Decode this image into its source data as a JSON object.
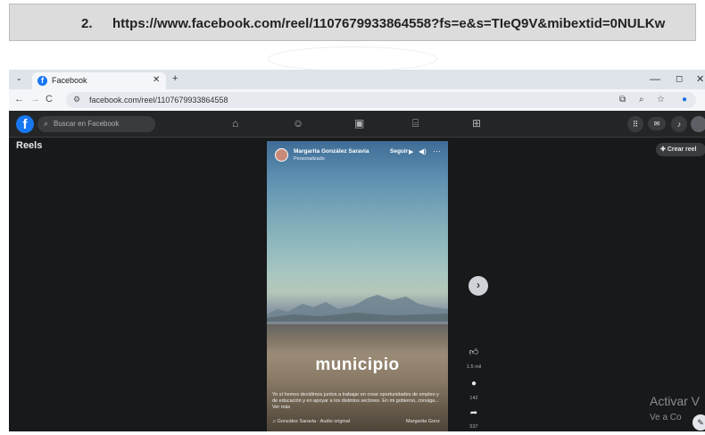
{
  "caption": {
    "number": "2.",
    "url": "https://www.facebook.com/reel/1107679933864558?fs=e&s=TIeQ9V&mibextid=0NULKw"
  },
  "browser": {
    "tab_title": "Facebook",
    "tab_close": "✕",
    "new_tab": "+",
    "tab_menu": "⌄",
    "win_minimize": "—",
    "win_maximize": "◻",
    "win_close": "✕",
    "address": "facebook.com/reel/1107679933864558",
    "nav_back": "←",
    "nav_forward": "→",
    "nav_reload": "C"
  },
  "facebook": {
    "logo": "f",
    "search_placeholder": "Buscar en Facebook",
    "reels_label": "Reels",
    "create_reel": "Crear reel"
  },
  "reel": {
    "author": "Margarita González Saravia",
    "subtitle": "Personalizado",
    "follow": "Seguir",
    "overlay_word": "municipio",
    "caption": "Yo sí hemos decidimos juntos a trabajar en crear oportunidades de empleo y de educación y en apoyar a los distintos sectores. En mi gobierno, consiga... Ver más",
    "audio": "González Saravia · Audio original",
    "audio_right": "Margarita Gonz"
  },
  "actions": {
    "likes": "1.5 mil",
    "comments": "142",
    "shares": "537"
  },
  "windows_activation": {
    "title": "Activar V",
    "subtitle": "Ve a Co"
  },
  "icons": {
    "favicon": "facebook-icon",
    "home": "home-icon",
    "friends": "friends-icon",
    "watch": "video-icon",
    "marketplace": "marketplace-icon",
    "gaming": "gaming-icon",
    "menu": "menu-grid-icon",
    "messenger": "messenger-icon",
    "notifications": "bell-icon",
    "account": "avatar"
  },
  "colors": {
    "fb_blue": "#1877f2",
    "fb_dark": "#18191a",
    "fb_bar": "#242526"
  }
}
